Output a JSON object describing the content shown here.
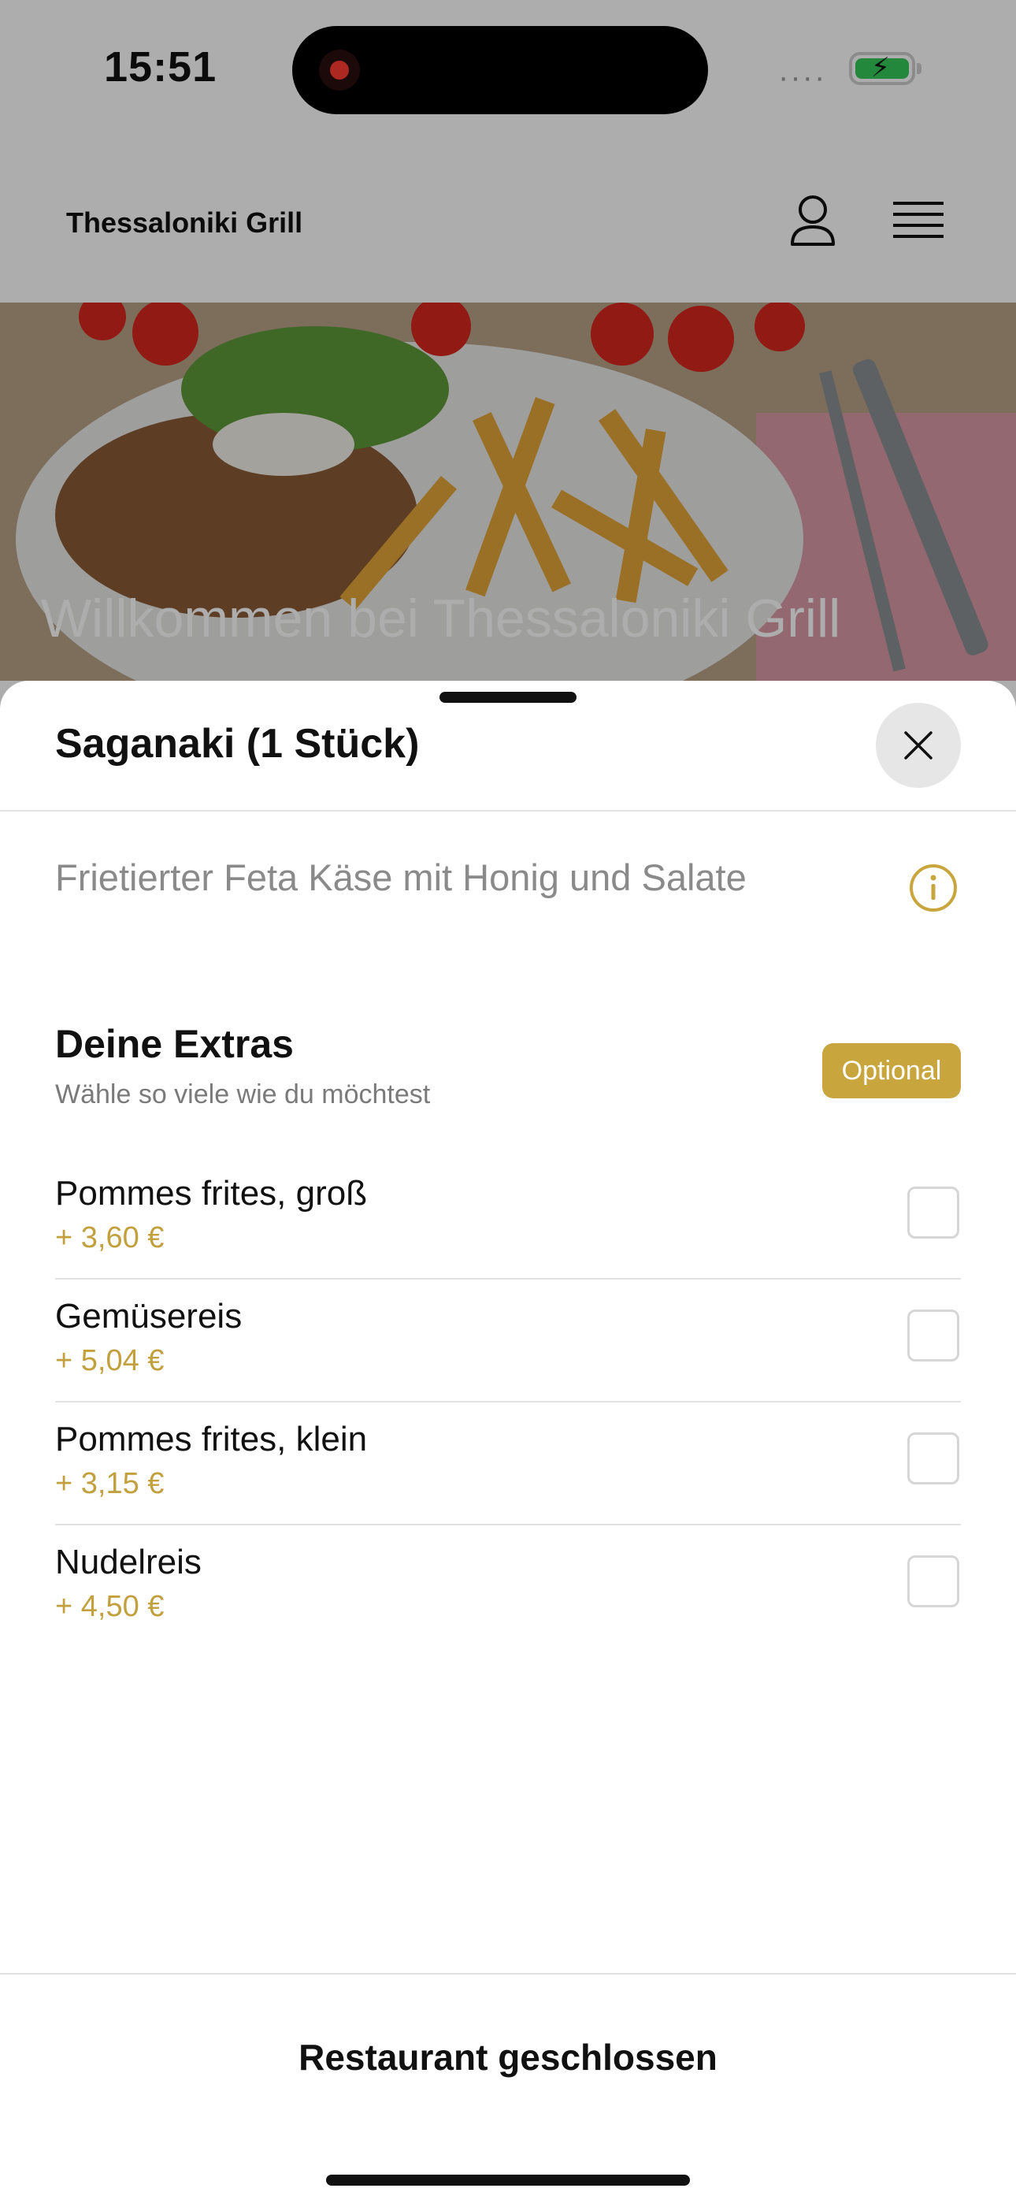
{
  "status_bar": {
    "time": "15:51",
    "signal": "····",
    "battery_level": 1.0
  },
  "app_bar": {
    "brand": "Thessaloniki Grill",
    "user_icon": "user-icon",
    "menu_icon": "hamburger-menu-icon"
  },
  "hero": {
    "headline": "Willkommen bei Thessaloniki Grill"
  },
  "sheet": {
    "title": "Saganaki (1 Stück)",
    "description": "Frietierter Feta Käse mit Honig und Salate",
    "extras": {
      "title": "Deine Extras",
      "subtitle": "Wähle so viele wie du möchtest",
      "badge": "Optional",
      "options": [
        {
          "name": "Pommes frites, groß",
          "price": "+ 3,60 €",
          "checked": false
        },
        {
          "name": "Gemüsereis",
          "price": "+ 5,04 €",
          "checked": false
        },
        {
          "name": "Pommes frites, klein",
          "price": "+ 3,15 €",
          "checked": false
        },
        {
          "name": "Nudelreis",
          "price": "+ 4,50 €",
          "checked": false
        }
      ]
    },
    "footer": "Restaurant geschlossen"
  },
  "colors": {
    "accent": "#c9a53d",
    "price": "#c2a03e",
    "text": "#111111",
    "muted": "#8a8a8a"
  }
}
